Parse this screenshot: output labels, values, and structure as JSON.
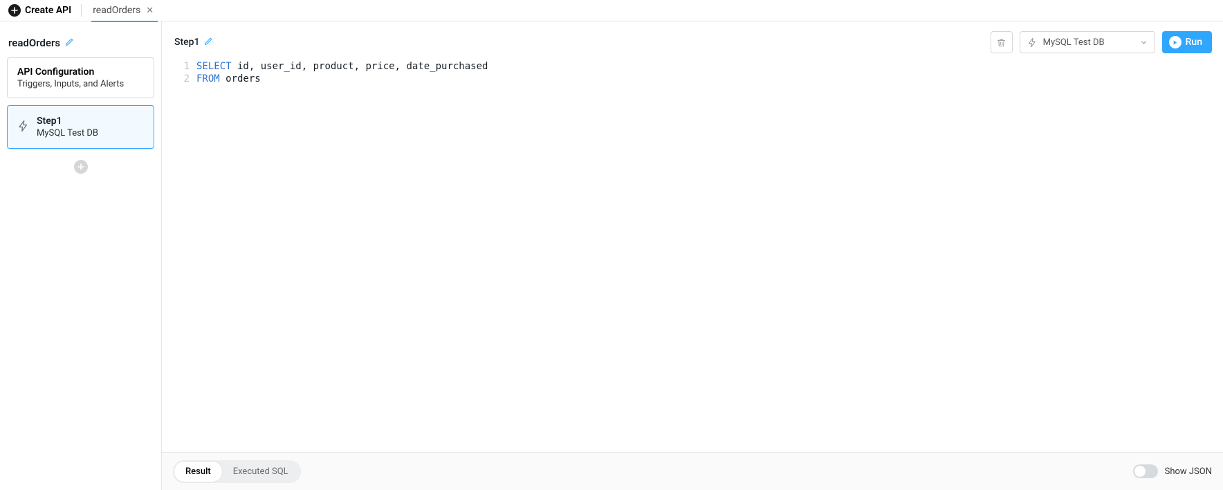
{
  "topbar": {
    "create_api_label": "Create API",
    "tabs": [
      {
        "label": "readOrders",
        "active": true
      }
    ]
  },
  "sidebar": {
    "api_name": "readOrders",
    "config_card": {
      "title": "API Configuration",
      "subtitle": "Triggers, Inputs, and Alerts"
    },
    "steps": [
      {
        "title": "Step1",
        "subtitle": "MySQL Test DB",
        "active": true
      }
    ]
  },
  "main": {
    "step_title": "Step1",
    "db_select_label": "MySQL Test DB",
    "run_label": "Run",
    "editor_lines": [
      {
        "n": "1",
        "segments": [
          {
            "t": "SELECT",
            "kw": true
          },
          {
            "t": " id, user_id, product, price, date_purchased",
            "kw": false
          }
        ]
      },
      {
        "n": "2",
        "segments": [
          {
            "t": "FROM",
            "kw": true
          },
          {
            "t": " orders",
            "kw": false
          }
        ]
      }
    ]
  },
  "footer": {
    "tabs": [
      {
        "label": "Result",
        "active": true
      },
      {
        "label": "Executed SQL",
        "active": false
      }
    ],
    "show_json_label": "Show JSON",
    "show_json": false
  },
  "colors": {
    "accent": "#2fa7ff"
  }
}
